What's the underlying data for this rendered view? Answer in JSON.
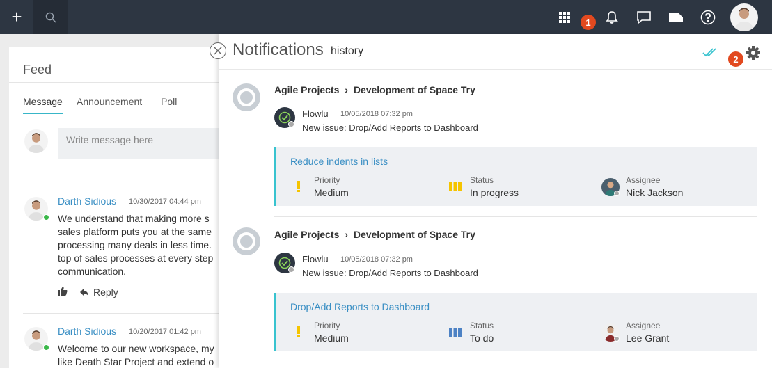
{
  "topbar": {
    "plus_label": "+",
    "badge_apps": "1",
    "badge_settings": "2"
  },
  "feed": {
    "title": "Feed",
    "tabs": [
      "Message",
      "Announcement",
      "Poll"
    ],
    "write_placeholder": "Write message here",
    "posts": [
      {
        "author": "Darth Sidious",
        "time": "10/30/2017 04:44 pm",
        "lines": [
          "We understand that making more s",
          "sales platform puts you at the same",
          "processing many deals in less time.",
          "top of sales processes at every step",
          "communication."
        ],
        "reply": "Reply"
      },
      {
        "author": "Darth Sidious",
        "time": "10/20/2017 01:42 pm",
        "lines": [
          "Welcome to our new workspace, my",
          "like Death Star Project and extend o"
        ]
      }
    ]
  },
  "panel": {
    "title": "Notifications",
    "subtitle": "history",
    "notifications": [
      {
        "project": "Agile Projects",
        "sub": "Development of Space Try",
        "sender": "Flowlu",
        "time": "10/05/2018 07:32 pm",
        "text": "New issue: Drop/Add Reports to Dashboard",
        "card": {
          "title": "Reduce indents in lists",
          "priority_label": "Priority",
          "priority": "Medium",
          "status_label": "Status",
          "status": "In progress",
          "assignee_label": "Assignee",
          "assignee": "Nick Jackson"
        }
      },
      {
        "project": "Agile Projects",
        "sub": "Development of Space Try",
        "sender": "Flowlu",
        "time": "10/05/2018 07:32 pm",
        "text": "New issue: Drop/Add Reports to Dashboard",
        "card": {
          "title": "Drop/Add Reports to Dashboard",
          "priority_label": "Priority",
          "priority": "Medium",
          "status_label": "Status",
          "status": "To do",
          "assignee_label": "Assignee",
          "assignee": "Lee Grant"
        }
      }
    ]
  },
  "colors": {
    "topbar": "#2d3642",
    "accent": "#38c3cf",
    "link": "#3a8fc4",
    "badge": "#e2491f",
    "priority": "#f5c400",
    "status_progress": "#f5c400",
    "status_todo": "#4d82c4"
  }
}
